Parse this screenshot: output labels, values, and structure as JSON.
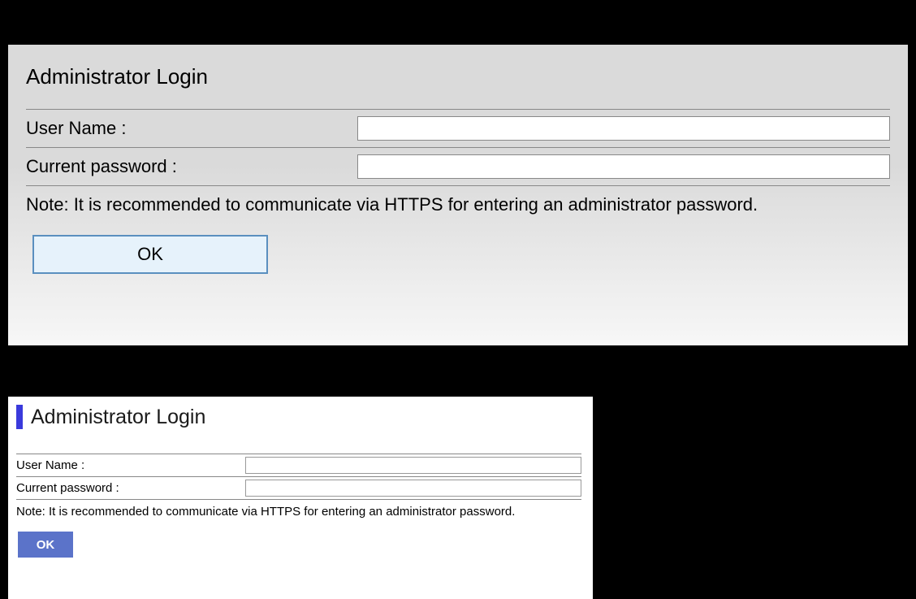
{
  "panel1": {
    "title": "Administrator Login",
    "username_label": "User Name :",
    "username_value": "",
    "password_label": "Current password :",
    "password_value": "",
    "note": "Note: It is recommended to communicate via HTTPS for entering an administrator password.",
    "ok_label": "OK"
  },
  "panel2": {
    "title": "Administrator Login",
    "username_label": "User Name :",
    "username_value": "",
    "password_label": "Current password :",
    "password_value": "",
    "note": "Note: It is recommended to communicate via HTTPS for entering an administrator password.",
    "ok_label": "OK",
    "accent_color": "#3a3adc"
  }
}
